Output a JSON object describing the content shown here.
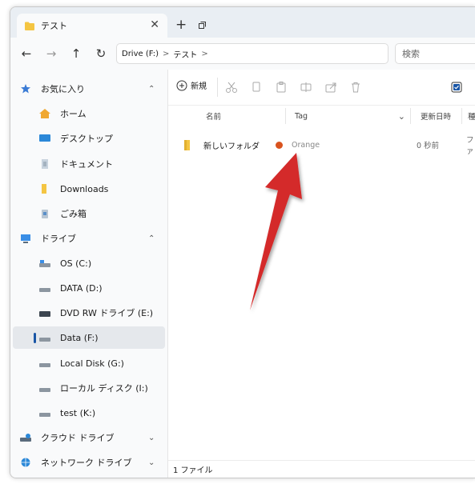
{
  "tab": {
    "title": "テスト",
    "close": "✕",
    "new": "+"
  },
  "nav": {
    "back": "←",
    "forward": "→",
    "up": "↑",
    "refresh": "↻",
    "breadcrumb": [
      "Drive (F:)",
      "テスト"
    ],
    "sep": ">",
    "search_placeholder": "検索"
  },
  "sidebar": {
    "items": [
      {
        "label": "お気に入り",
        "icon": "star-icon",
        "chevron": "^"
      },
      {
        "label": "ホーム",
        "icon": "home-icon"
      },
      {
        "label": "デスクトップ",
        "icon": "desktop-icon"
      },
      {
        "label": "ドキュメント",
        "icon": "document-icon"
      },
      {
        "label": "Downloads",
        "icon": "folder-icon"
      },
      {
        "label": "ごみ箱",
        "icon": "recycle-bin-icon"
      },
      {
        "label": "ドライブ",
        "icon": "pc-icon",
        "chevron": "^"
      },
      {
        "label": "OS (C:)",
        "icon": "drive-icon"
      },
      {
        "label": "DATA (D:)",
        "icon": "drive-icon"
      },
      {
        "label": "DVD RW ドライブ (E:)",
        "icon": "dvd-drive-icon"
      },
      {
        "label": "Data (F:)",
        "icon": "drive-icon"
      },
      {
        "label": "Local Disk (G:)",
        "icon": "drive-icon"
      },
      {
        "label": "ローカル ディスク (I:)",
        "icon": "drive-icon"
      },
      {
        "label": "test (K:)",
        "icon": "drive-icon"
      },
      {
        "label": "クラウド ドライブ",
        "icon": "cloud-drive-icon",
        "chevron": "v"
      },
      {
        "label": "ネットワーク ドライブ",
        "icon": "network-drive-icon",
        "chevron": "v"
      }
    ]
  },
  "toolbar": {
    "new_label": "新規"
  },
  "columns": {
    "name": "名前",
    "tag": "Tag",
    "modified": "更新日時",
    "type": "種"
  },
  "rows": [
    {
      "name": "新しいフォルダ",
      "tag": "Orange",
      "tag_color": "#d9531e",
      "modified": "0 秒前",
      "type": "ファ"
    }
  ],
  "status": {
    "count": "1 ファイル"
  },
  "colors": {
    "accent": "#1a56a6",
    "arrow": "#d42a2a",
    "folder": "#f4c542"
  }
}
